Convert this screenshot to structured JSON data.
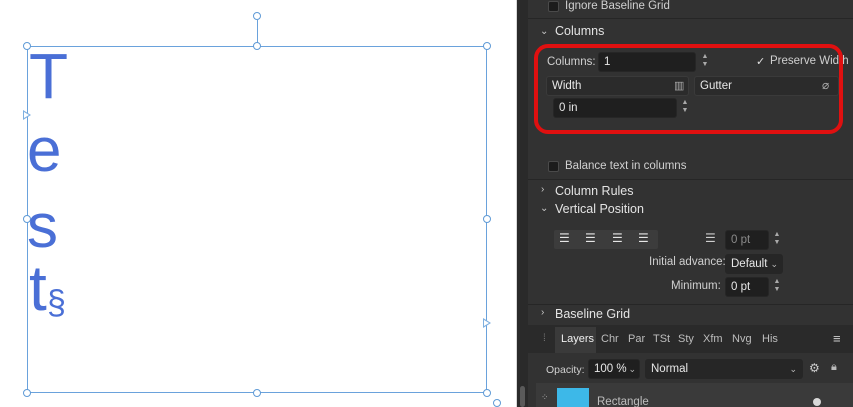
{
  "canvas": {
    "letters": [
      "T",
      "e",
      "s",
      "t"
    ],
    "section_mark": "§"
  },
  "panel": {
    "ignore_baseline_grid": "Ignore Baseline Grid",
    "columns_section": "Columns",
    "columns_label": "Columns:",
    "columns_value": "1",
    "preserve_width_label": "Preserve Width",
    "preserve_width_checked": true,
    "width_label": "Width",
    "gutter_label": "Gutter",
    "width_value": "0 in",
    "balance_text_label": "Balance text in columns",
    "column_rules_section": "Column Rules",
    "vertical_position_section": "Vertical Position",
    "vertical_offset_value": "0 pt",
    "initial_advance_label": "Initial advance:",
    "initial_advance_value": "Default",
    "minimum_label": "Minimum:",
    "minimum_value": "0 pt",
    "baseline_grid_section": "Baseline Grid",
    "tabs": [
      "Layers",
      "Chr",
      "Par",
      "TSt",
      "Sty",
      "Xfm",
      "Nvg",
      "His"
    ],
    "active_tab": "Layers",
    "opacity_label": "Opacity:",
    "opacity_value": "100 %",
    "blend_mode": "Normal",
    "layer_name": "Rectangle",
    "icons": [
      "chevron-down-icon",
      "chevron-right-icon",
      "checkmark-icon",
      "spinner-icon",
      "column-width-icon",
      "link-icon",
      "align-top-icon",
      "align-center-icon",
      "align-justify-icon",
      "align-bottom-icon",
      "baseline-offset-icon",
      "hamburger-menu-icon",
      "gear-icon",
      "lock-icon",
      "grip-icon"
    ],
    "accent_color": "#e01010",
    "layer_thumb_color": "#3db8e8"
  }
}
